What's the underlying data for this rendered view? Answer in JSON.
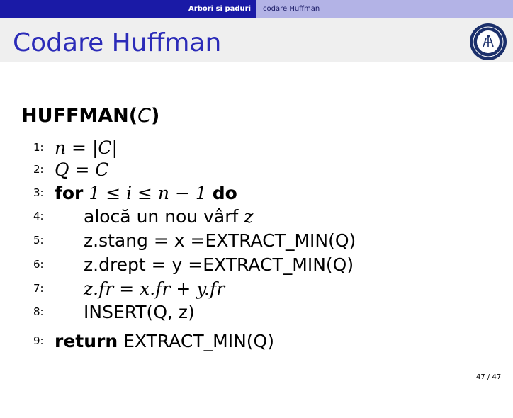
{
  "nav": {
    "left": "Arbori si paduri",
    "right": "codare Huffman"
  },
  "slide_title": "Codare Huffman",
  "heading": {
    "prefix": "HUFFMAN(",
    "param": "C",
    "suffix": ")"
  },
  "lines": [
    {
      "num": "1:",
      "text": "n = |C|"
    },
    {
      "num": "2:",
      "text": "Q = C"
    },
    {
      "num": "3:",
      "kw": "for",
      "text": "1 ≤ i ≤ n − 1",
      "kw2": "do"
    },
    {
      "num": "4:",
      "text": "alocă un nou vârf",
      "var": "z"
    },
    {
      "num": "5:",
      "text": "z.stang = x =EXTRACT_MIN(Q)"
    },
    {
      "num": "6:",
      "text": "z.drept = y =EXTRACT_MIN(Q)"
    },
    {
      "num": "7:",
      "text": "z.fr = x.fr + y.fr"
    },
    {
      "num": "8:",
      "text": "INSERT(Q, z)"
    },
    {
      "num": "9:",
      "kw": "return",
      "text": "EXTRACT_MIN(Q)"
    }
  ],
  "page_number": "47 / 47"
}
